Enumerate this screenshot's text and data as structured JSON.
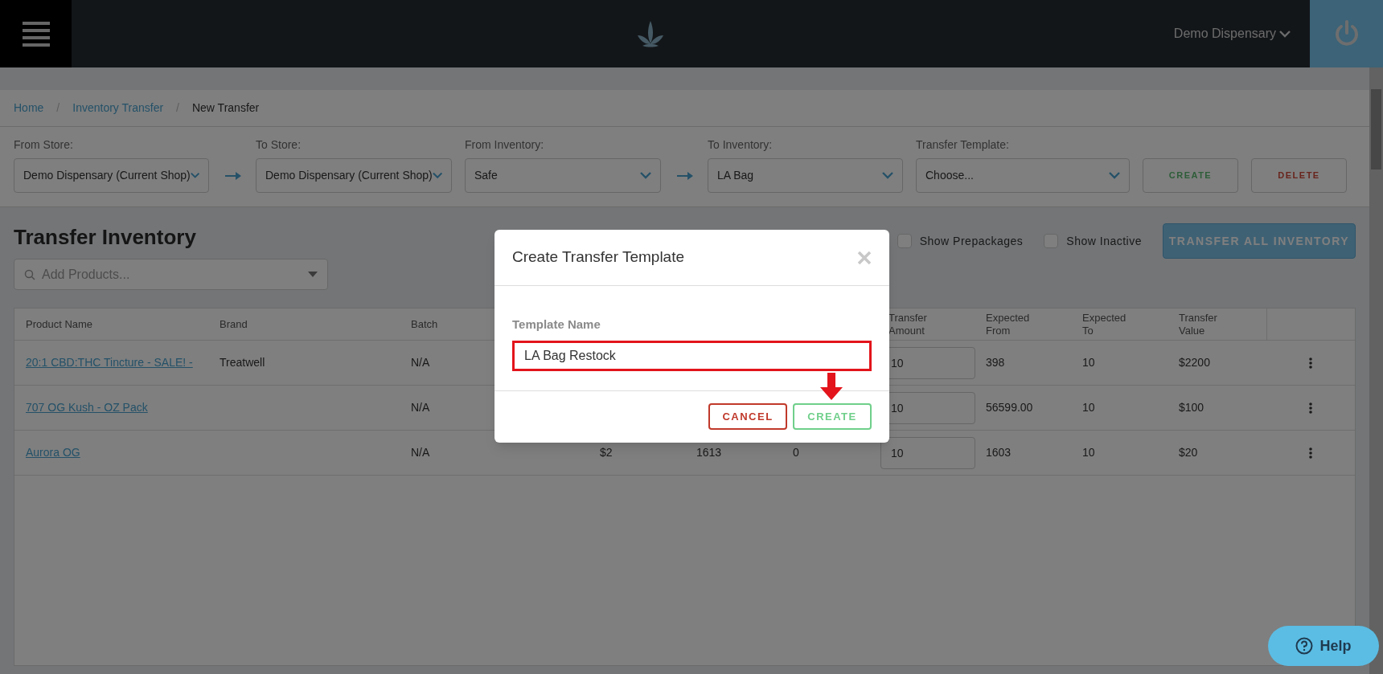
{
  "header": {
    "account": "Demo Dispensary"
  },
  "breadcrumb": [
    {
      "label": "Home",
      "kind": "link"
    },
    {
      "label": "/",
      "kind": "separator"
    },
    {
      "label": "Inventory Transfer",
      "kind": "link"
    },
    {
      "label": "/",
      "kind": "separator"
    },
    {
      "label": "New Transfer",
      "kind": "current"
    }
  ],
  "filters": [
    {
      "label": "From Store:",
      "value": "Demo Dispensary (Current Shop)",
      "arrow_after": true
    },
    {
      "label": "To Store:",
      "value": "Demo Dispensary (Current Shop)",
      "arrow_after": false
    },
    {
      "label": "From Inventory:",
      "value": "Safe",
      "arrow_after": true
    },
    {
      "label": "To Inventory:",
      "value": "LA Bag",
      "arrow_after": false
    },
    {
      "label": "Transfer Template:",
      "value": "Choose...",
      "arrow_after": false
    }
  ],
  "template_buttons": [
    {
      "label": "CREATE",
      "kind": "create"
    },
    {
      "label": "DELETE",
      "kind": "delete"
    }
  ],
  "title": "Transfer Inventory",
  "options": [
    {
      "label": "Show Prepackages",
      "checked": false
    },
    {
      "label": "Show Inactive",
      "checked": false
    }
  ],
  "transfer_all_button": "TRANSFER ALL INVENTORY",
  "search": {
    "placeholder": "Add Products..."
  },
  "table": {
    "columns": [
      "Product Name",
      "Brand",
      "Batch",
      "Transfer Amount",
      "Expected From",
      "Expected To",
      "Transfer Value"
    ],
    "rows": [
      {
        "product": "20:1 CBD:THC Tincture - SALE! -",
        "brand": "Treatwell",
        "batch": "N/A",
        "amount": "10",
        "from": "398",
        "to": "10",
        "value": "$2200"
      },
      {
        "product": "707 OG Kush - OZ Pack",
        "batch": "N/A",
        "amount": "10",
        "from": "56599.00",
        "to": "10",
        "value": "$100"
      },
      {
        "product": "Aurora OG",
        "batch": "N/A",
        "column_4": "$2",
        "column_5": "1613",
        "column_6": "0",
        "amount": "10",
        "from": "1603",
        "to": "10",
        "value": "$20"
      }
    ]
  },
  "modal": {
    "title": "Create Transfer Template",
    "field_label": "Template Name",
    "field_value": "LA Bag Restock",
    "highlighted": true,
    "buttons": [
      {
        "label": "CANCEL",
        "kind": "cancel"
      },
      {
        "label": "CREATE",
        "kind": "create"
      }
    ]
  },
  "help_button": "Help"
}
